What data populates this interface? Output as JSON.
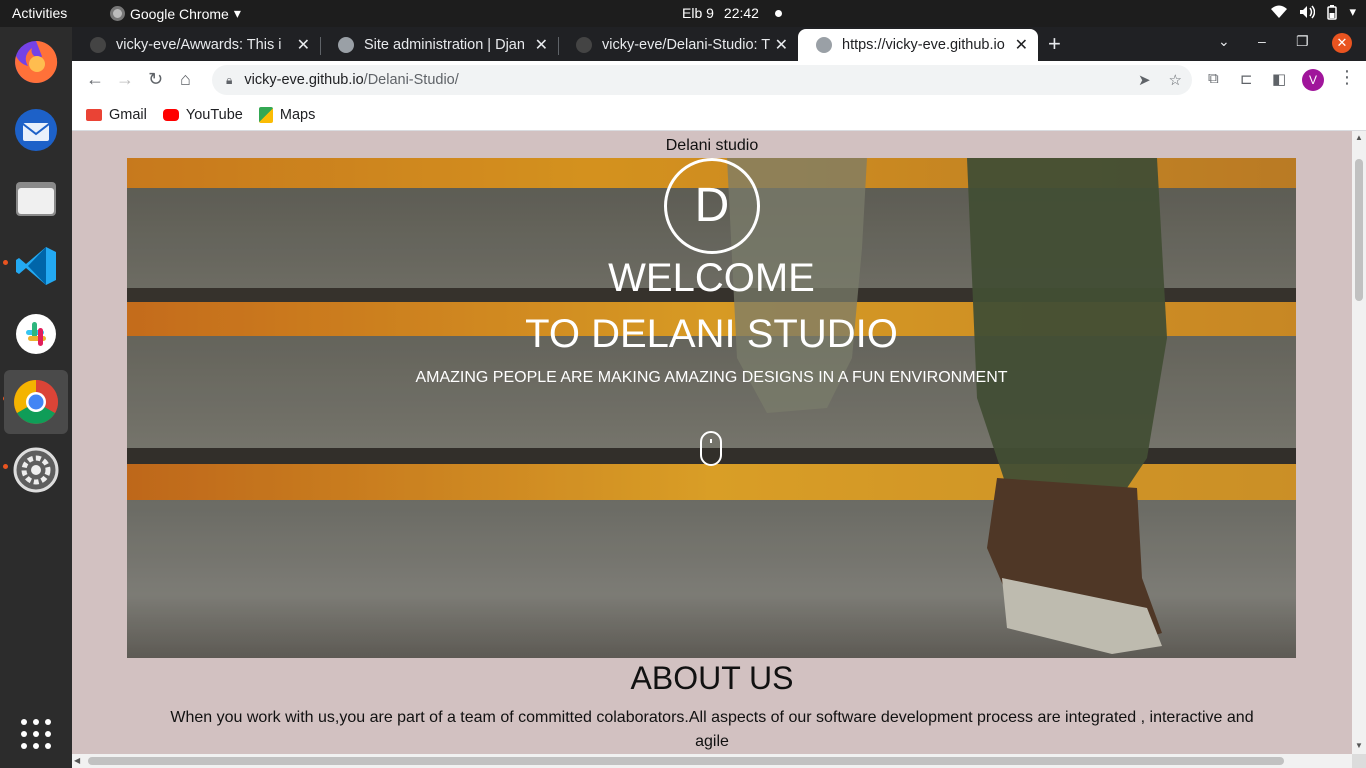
{
  "topbar": {
    "activities": "Activities",
    "app_name": "Google Chrome",
    "date": "Elb 9",
    "time": "22:42"
  },
  "dock": {
    "apps": [
      "firefox-icon",
      "thunderbird-icon",
      "files-icon",
      "vscode-icon",
      "slack-icon",
      "chrome-icon",
      "settings-icon",
      "app-grid-icon"
    ]
  },
  "tabs": [
    {
      "title": "vicky-eve/Awwards: This i",
      "favicon": "github-icon"
    },
    {
      "title": "Site administration | Djan",
      "favicon": "globe-icon"
    },
    {
      "title": "vicky-eve/Delani-Studio: T",
      "favicon": "github-icon"
    },
    {
      "title": "https://vicky-eve.github.io",
      "favicon": "globe-icon"
    }
  ],
  "omnibox": {
    "host": "vicky-eve.github.io",
    "path": "/Delani-Studio/"
  },
  "profile_initial": "V",
  "bookmarks": [
    {
      "label": "Gmail",
      "color": "#ea4335"
    },
    {
      "label": "YouTube",
      "color": "#ff0000"
    },
    {
      "label": "Maps",
      "color": "#34a853"
    }
  ],
  "page": {
    "site_title": "Delani studio",
    "logo_letter": "D",
    "welcome": "WELCOME",
    "studio": "TO DELANI STUDIO",
    "tagline": "AMAZING PEOPLE ARE MAKING AMAZING DESIGNS IN A FUN ENVIRONMENT",
    "about_heading": "ABOUT US",
    "about_text": "When you work with us,you are part of a team of committed colaborators.All aspects of our software development process are integrated , interactive and agile"
  },
  "colors": {
    "page_bg": "#d2c1c1",
    "stripe_yellow": "#f2a623",
    "active_dot": "#e95420"
  }
}
